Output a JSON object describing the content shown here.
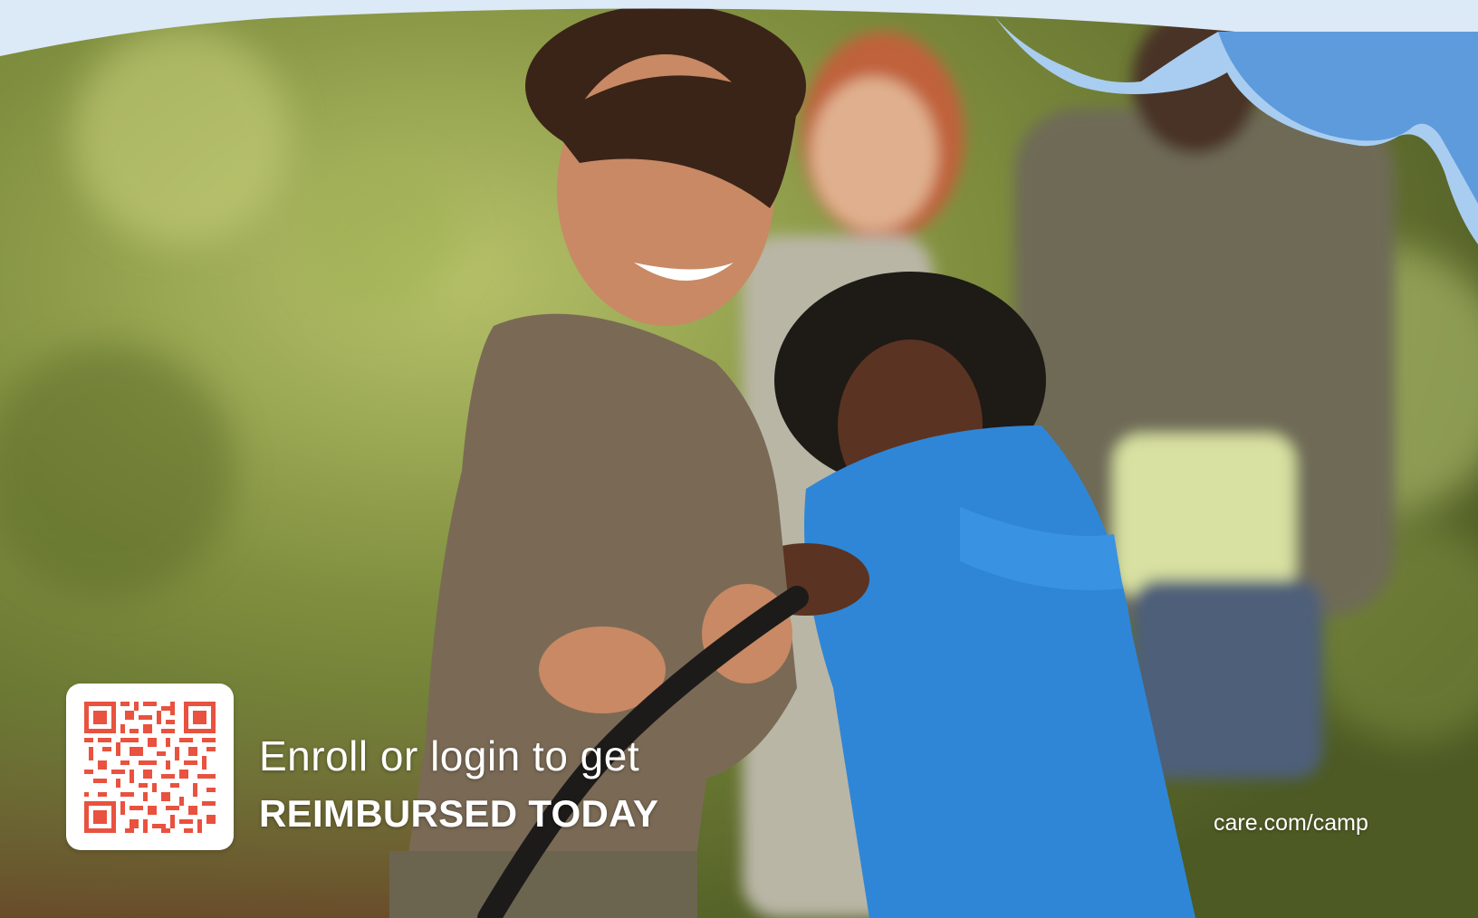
{
  "cta": {
    "line1": "Enroll or login to get",
    "line2": "REIMBURSED TODAY"
  },
  "footer": {
    "url": "care.com/camp"
  },
  "colors": {
    "qr_red": "#e8523e",
    "wave_light": "#dce9f7",
    "wave_mid": "#a9cdf0",
    "wave_dark": "#5e9bdc"
  }
}
